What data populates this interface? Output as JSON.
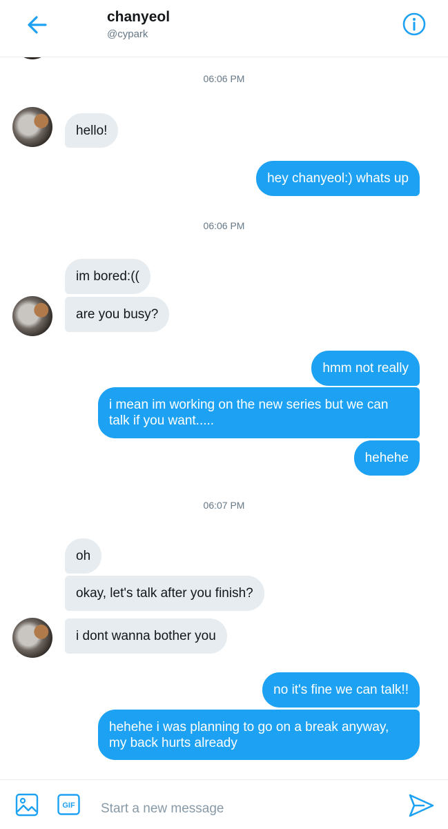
{
  "header": {
    "name": "chanyeol",
    "handle": "@cypark"
  },
  "colors": {
    "accent": "#1da1f2",
    "received_bubble": "#e6ecf0",
    "timestamp": "#657786"
  },
  "icons": {
    "back": "arrow-left-icon",
    "info": "info-icon",
    "media": "image-icon",
    "gif": "gif-icon",
    "send": "send-icon"
  },
  "conversation": {
    "timestamps": [
      "06:06 PM",
      "06:06 PM",
      "06:07 PM"
    ],
    "messages": [
      {
        "sender": "them",
        "text": "hello!"
      },
      {
        "sender": "me",
        "text": "hey chanyeol:) whats up"
      },
      {
        "sender": "them",
        "text": "im bored:(("
      },
      {
        "sender": "them",
        "text": "are you busy?"
      },
      {
        "sender": "me",
        "text": "hmm not really"
      },
      {
        "sender": "me",
        "text": "i mean im working on the new series but we can talk if you want....."
      },
      {
        "sender": "me",
        "text": "hehehe"
      },
      {
        "sender": "them",
        "text": "oh"
      },
      {
        "sender": "them",
        "text": "okay, let's talk after you finish?"
      },
      {
        "sender": "them",
        "text": "i dont wanna bother you"
      },
      {
        "sender": "me",
        "text": "no it's fine we can talk!!"
      },
      {
        "sender": "me",
        "text": "hehehe i was planning to go on a break anyway, my back hurts already"
      }
    ]
  },
  "composer": {
    "placeholder": "Start a new message",
    "gif_label": "GIF"
  }
}
